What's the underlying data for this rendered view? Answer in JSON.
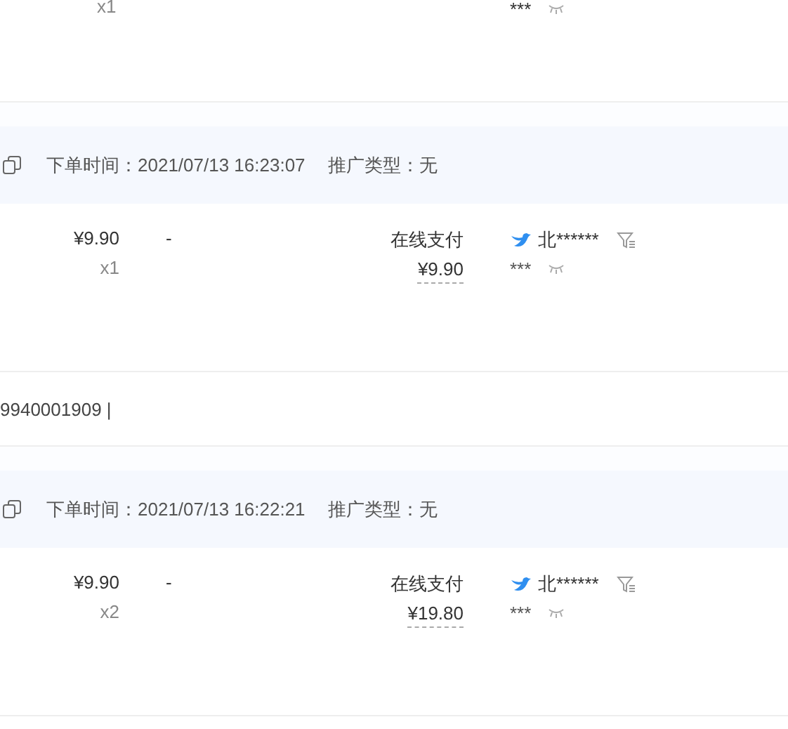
{
  "top_fragment": {
    "quantity": "x1",
    "buyer_masked": "***"
  },
  "orders": [
    {
      "order_time": "下单时间：2021/07/13 16:23:07",
      "promo_type": "推广类型：无",
      "price": "¥9.90",
      "quantity": "x1",
      "discount": "-",
      "payment_method": "在线支付",
      "paid": "¥9.90",
      "buyer_name": "北******",
      "buyer_masked": "***",
      "footer": "9940001909 |"
    },
    {
      "order_time": "下单时间：2021/07/13 16:22:21",
      "promo_type": "推广类型：无",
      "price": "¥9.90",
      "quantity": "x2",
      "discount": "-",
      "payment_method": "在线支付",
      "paid": "¥19.80",
      "buyer_name": "北******",
      "buyer_masked": "***"
    }
  ]
}
